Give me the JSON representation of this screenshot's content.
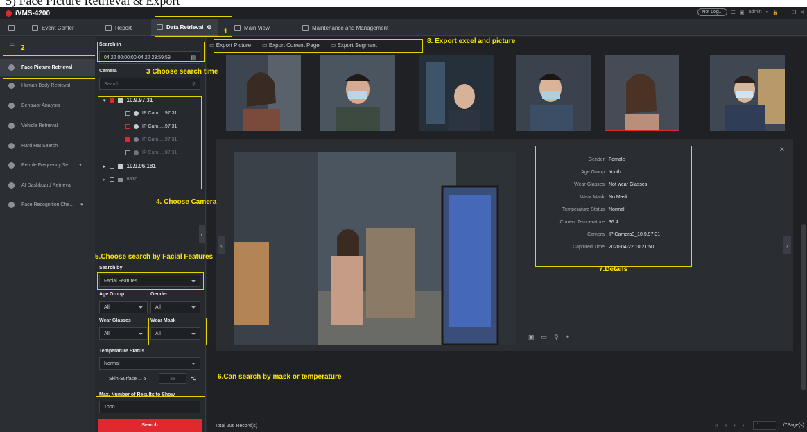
{
  "doc_heading": "5)   Face Picture Retrieval & Export",
  "app": {
    "title": "iVMS-4200",
    "not_logged": "Not Log...",
    "user": "admin"
  },
  "menu": {
    "event_center": "Event Center",
    "report": "Report",
    "data_retrieval": "Data Retrieval",
    "main_view": "Main View",
    "maintenance": "Maintenance and Management"
  },
  "sidebar": {
    "items": [
      {
        "label": "Face Picture Retrieval"
      },
      {
        "label": "Human Body Retrieval"
      },
      {
        "label": "Behavior Analysis"
      },
      {
        "label": "Vehicle Retrieval"
      },
      {
        "label": "Hard Hat Search"
      },
      {
        "label": "People Frequency Se..."
      },
      {
        "label": "AI Dashboard Retrieval"
      },
      {
        "label": "Face Recognition Che..."
      }
    ]
  },
  "panel": {
    "search_in_label": "Search in",
    "search_in_value": "04.22 00:00:00-04.22 23:59:59",
    "camera_label": "Camera",
    "camera_search_placeholder": "Search",
    "tree": [
      {
        "label": "10.9.97.31"
      },
      {
        "label": "IP Cam.....97.31"
      },
      {
        "label": "IP Cam.....97.31"
      },
      {
        "label": "IP Cam.....97.31"
      },
      {
        "label": "IP Cam.....97.31"
      },
      {
        "label": "10.9.96.181"
      },
      {
        "label": "6810"
      }
    ],
    "search_by_label": "Search by",
    "search_by_value": "Facial Features",
    "age_group_label": "Age Group",
    "age_group_value": "All",
    "gender_label": "Gender",
    "gender_value": "All",
    "wear_glasses_label": "Wear Glasses",
    "wear_glasses_value": "All",
    "wear_mask_label": "Wear Mask",
    "wear_mask_value": "All",
    "temperature_status_label": "Temperature Status",
    "temperature_status_value": "Normal",
    "skin_surface_label": "Skin-Surface ... ≥",
    "skin_surface_value": "38",
    "skin_surface_unit": "℃",
    "max_results_label": "Max. Number of Results to Show",
    "max_results_value": "1000",
    "search_button": "Search"
  },
  "export": {
    "picture": "Export Picture",
    "current_page": "Export Current Page",
    "segment": "Export Segment"
  },
  "details": [
    {
      "key": "Gender",
      "value": "Female"
    },
    {
      "key": "Age Group",
      "value": "Youth"
    },
    {
      "key": "Wear Glasses",
      "value": "Not wear Glasses"
    },
    {
      "key": "Wear Mask",
      "value": "No Mask"
    },
    {
      "key": "Temperature Status",
      "value": "Normal"
    },
    {
      "key": "Current Temperature",
      "value": "36.4"
    },
    {
      "key": "Camera",
      "value": "IP Camera3_10.9.97.31"
    },
    {
      "key": "Captured Time",
      "value": "2020-04-22 10:21:50"
    }
  ],
  "footer": {
    "total": "Total 206 Record(s)",
    "page": "1",
    "page_total": "/7Page(s)"
  },
  "annotations": {
    "a1": "1",
    "a2": "2",
    "a3": "3  Choose search time",
    "a4": "4. Choose Camera",
    "a5": "5.Choose search by Facial Features",
    "a6": "6.Can search by mask or temperature",
    "a7": "7.Details",
    "a8": "8. Export excel and picture"
  },
  "colors": {
    "accent_red": "#e0292f",
    "annotation_yellow": "#e6d400"
  }
}
